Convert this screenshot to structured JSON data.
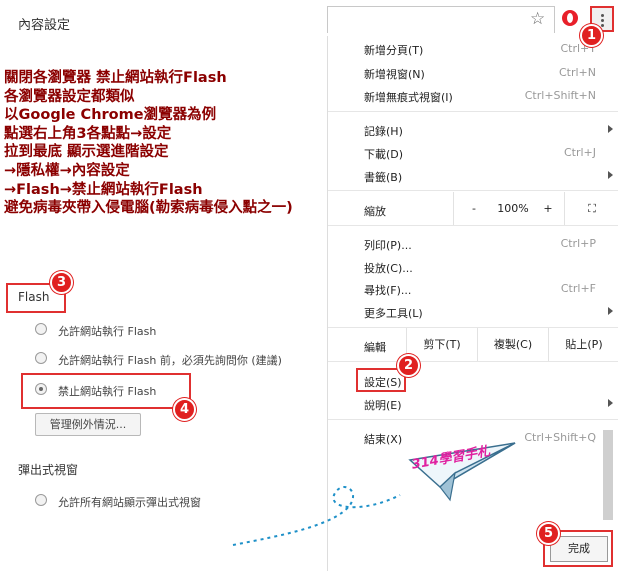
{
  "settings_panel": {
    "title": "內容設定",
    "flash_heading": "Flash",
    "options": [
      {
        "label": "允許網站執行 Flash",
        "selected": false
      },
      {
        "label": "允許網站執行 Flash 前，必須先詢問你 (建議)",
        "selected": false
      },
      {
        "label": "禁止網站執行 Flash",
        "selected": true
      }
    ],
    "manage_button": "管理例外情況...",
    "popup_heading": "彈出式視窗",
    "popup_option": "允許所有網站顯示彈出式視窗"
  },
  "annotation_text": "關閉各瀏覽器 禁止網站執行Flash\n各瀏覽器設定都類似\n以Google Chrome瀏覽器為例\n點選右上角3各點點→設定\n拉到最底 顯示選進階設定\n→隱私權→內容設定\n→Flash→禁止網站執行Flash\n避免病毒夾帶入侵電腦(勒索病毒侵入點之一)",
  "badges": [
    "1",
    "2",
    "3",
    "4",
    "5"
  ],
  "menu": {
    "new_tab": {
      "label": "新增分頁(T)",
      "shortcut": "Ctrl+T"
    },
    "new_window": {
      "label": "新增視窗(N)",
      "shortcut": "Ctrl+N"
    },
    "incognito": {
      "label": "新增無痕式視窗(I)",
      "shortcut": "Ctrl+Shift+N"
    },
    "history": {
      "label": "記錄(H)"
    },
    "downloads": {
      "label": "下載(D)",
      "shortcut": "Ctrl+J"
    },
    "bookmarks": {
      "label": "書籤(B)"
    },
    "zoom": {
      "label": "縮放",
      "minus": "-",
      "value": "100%",
      "plus": "+"
    },
    "print": {
      "label": "列印(P)...",
      "shortcut": "Ctrl+P"
    },
    "cast": {
      "label": "投放(C)..."
    },
    "find": {
      "label": "尋找(F)...",
      "shortcut": "Ctrl+F"
    },
    "more_tools": {
      "label": "更多工具(L)"
    },
    "edit": {
      "label": "編輯",
      "cut": "剪下(T)",
      "copy": "複製(C)",
      "paste": "貼上(P)"
    },
    "settings": {
      "label": "設定(S)"
    },
    "help": {
      "label": "說明(E)"
    },
    "exit": {
      "label": "結束(X)",
      "shortcut": "Ctrl+Shift+Q"
    }
  },
  "done_button": "完成",
  "watermark": "314學習手札",
  "icons": [
    "star-icon",
    "opera-icon",
    "more-vert-icon",
    "fullscreen-icon",
    "paper-plane-icon"
  ],
  "colors": {
    "annotation": "#8b0000",
    "highlight_border": "#e03030",
    "badge": "#e02020",
    "watermark": "#e020a0"
  }
}
